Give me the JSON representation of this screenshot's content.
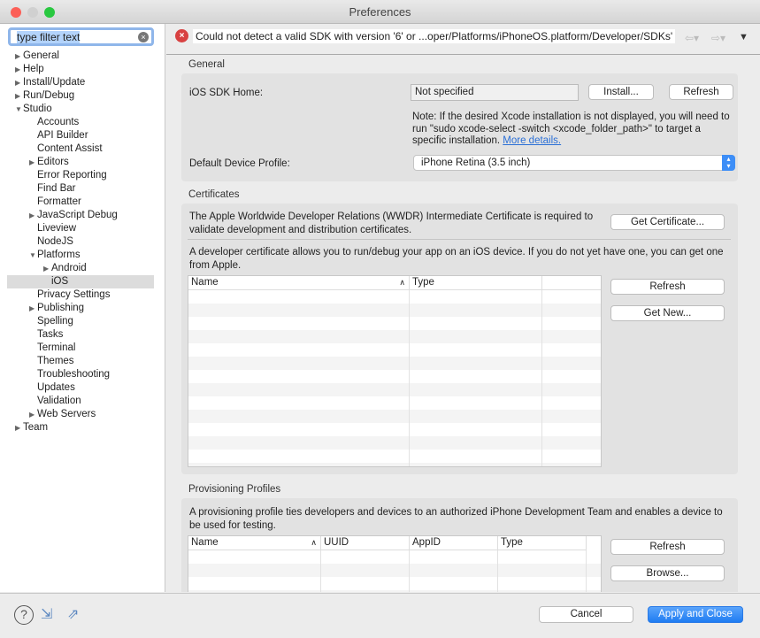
{
  "window": {
    "title": "Preferences"
  },
  "filter": {
    "value": "type filter text"
  },
  "tree": [
    {
      "label": "General",
      "level": 0,
      "arrow": "right"
    },
    {
      "label": "Help",
      "level": 0,
      "arrow": "right"
    },
    {
      "label": "Install/Update",
      "level": 0,
      "arrow": "right"
    },
    {
      "label": "Run/Debug",
      "level": 0,
      "arrow": "right"
    },
    {
      "label": "Studio",
      "level": 0,
      "arrow": "down"
    },
    {
      "label": "Accounts",
      "level": 1
    },
    {
      "label": "API Builder",
      "level": 1
    },
    {
      "label": "Content Assist",
      "level": 1
    },
    {
      "label": "Editors",
      "level": 1,
      "arrow": "right"
    },
    {
      "label": "Error Reporting",
      "level": 1
    },
    {
      "label": "Find Bar",
      "level": 1
    },
    {
      "label": "Formatter",
      "level": 1
    },
    {
      "label": "JavaScript Debug",
      "level": 1,
      "arrow": "right"
    },
    {
      "label": "Liveview",
      "level": 1
    },
    {
      "label": "NodeJS",
      "level": 1
    },
    {
      "label": "Platforms",
      "level": 1,
      "arrow": "down"
    },
    {
      "label": "Android",
      "level": 2,
      "arrow": "right"
    },
    {
      "label": "iOS",
      "level": 2,
      "selected": true
    },
    {
      "label": "Privacy Settings",
      "level": 1
    },
    {
      "label": "Publishing",
      "level": 1,
      "arrow": "right"
    },
    {
      "label": "Spelling",
      "level": 1
    },
    {
      "label": "Tasks",
      "level": 1
    },
    {
      "label": "Terminal",
      "level": 1
    },
    {
      "label": "Themes",
      "level": 1
    },
    {
      "label": "Troubleshooting",
      "level": 1
    },
    {
      "label": "Updates",
      "level": 1
    },
    {
      "label": "Validation",
      "level": 1
    },
    {
      "label": "Web Servers",
      "level": 1,
      "arrow": "right"
    },
    {
      "label": "Team",
      "level": 0,
      "arrow": "right"
    }
  ],
  "error": {
    "message": "Could not detect a valid SDK with version '6' or ...oper/Platforms/iPhoneOS.platform/Developer/SDKs'"
  },
  "general": {
    "title": "General",
    "sdk_label": "iOS SDK Home:",
    "sdk_value": "Not specified",
    "install": "Install...",
    "refresh": "Refresh",
    "note": "Note: If the desired Xcode installation is not displayed, you will need to run \"sudo xcode-select -switch <xcode_folder_path>\" to target a specific installation.",
    "more": "More details.",
    "device_label": "Default Device Profile:",
    "device_value": "iPhone Retina (3.5 inch)"
  },
  "certificates": {
    "title": "Certificates",
    "wwdr_text": "The Apple Worldwide Developer Relations (WWDR) Intermediate Certificate is required to validate development and distribution certificates.",
    "get_cert": "Get Certificate...",
    "dev_text": "A developer certificate allows you to run/debug your app on an iOS device. If you do not yet have one, you can get one from Apple.",
    "columns": [
      "Name",
      "Type"
    ],
    "refresh": "Refresh",
    "get_new": "Get New..."
  },
  "provisioning": {
    "title": "Provisioning Profiles",
    "text": "A provisioning profile ties developers and devices to an authorized iPhone Development Team and enables a device to be used for testing.",
    "columns": [
      "Name",
      "UUID",
      "AppID",
      "Type"
    ],
    "refresh": "Refresh",
    "browse": "Browse..."
  },
  "footer": {
    "cancel": "Cancel",
    "apply": "Apply and Close"
  }
}
